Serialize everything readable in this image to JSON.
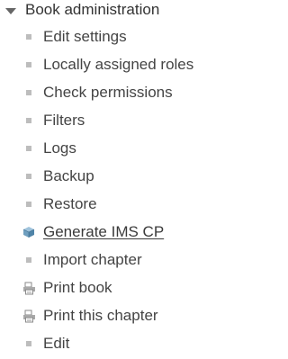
{
  "section": {
    "title": "Book administration",
    "expanded": true
  },
  "items": [
    {
      "label": "Edit settings",
      "icon": "bullet"
    },
    {
      "label": "Locally assigned roles",
      "icon": "bullet"
    },
    {
      "label": "Check permissions",
      "icon": "bullet"
    },
    {
      "label": "Filters",
      "icon": "bullet"
    },
    {
      "label": "Logs",
      "icon": "bullet"
    },
    {
      "label": "Backup",
      "icon": "bullet"
    },
    {
      "label": "Restore",
      "icon": "bullet"
    },
    {
      "label": "Generate IMS CP",
      "icon": "package-icon",
      "underlined": true
    },
    {
      "label": "Import chapter",
      "icon": "bullet"
    },
    {
      "label": "Print book",
      "icon": "printer-icon"
    },
    {
      "label": "Print this chapter",
      "icon": "printer-icon"
    },
    {
      "label": "Edit",
      "icon": "bullet"
    }
  ]
}
